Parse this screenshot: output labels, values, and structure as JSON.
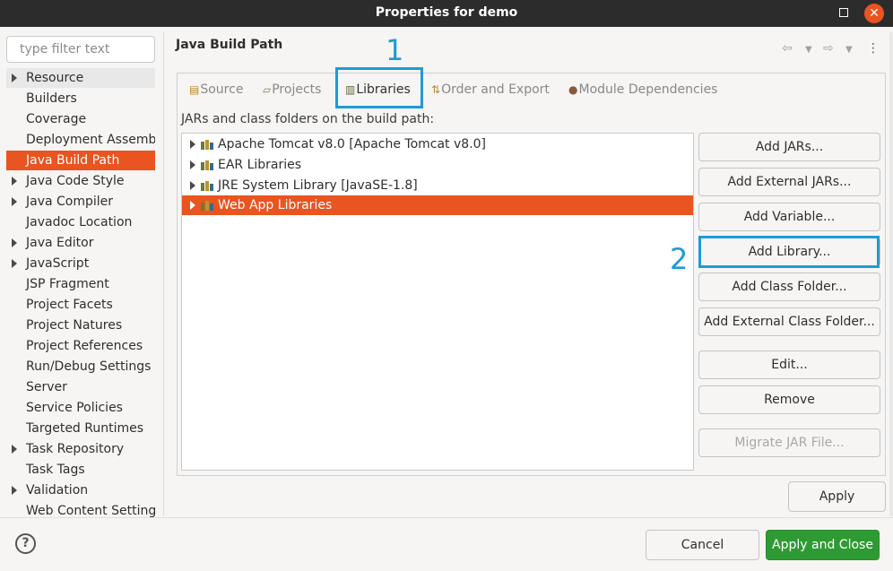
{
  "window": {
    "title": "Properties for demo"
  },
  "filter": {
    "placeholder": "type filter text"
  },
  "sidebar": {
    "items": [
      {
        "label": "Resource",
        "expandable": true,
        "state": "hover"
      },
      {
        "label": "Builders",
        "expandable": false
      },
      {
        "label": "Coverage",
        "expandable": false
      },
      {
        "label": "Deployment Assembly",
        "expandable": false
      },
      {
        "label": "Java Build Path",
        "expandable": false,
        "state": "selected"
      },
      {
        "label": "Java Code Style",
        "expandable": true
      },
      {
        "label": "Java Compiler",
        "expandable": true
      },
      {
        "label": "Javadoc Location",
        "expandable": false
      },
      {
        "label": "Java Editor",
        "expandable": true
      },
      {
        "label": "JavaScript",
        "expandable": true
      },
      {
        "label": "JSP Fragment",
        "expandable": false
      },
      {
        "label": "Project Facets",
        "expandable": false
      },
      {
        "label": "Project Natures",
        "expandable": false
      },
      {
        "label": "Project References",
        "expandable": false
      },
      {
        "label": "Run/Debug Settings",
        "expandable": false
      },
      {
        "label": "Server",
        "expandable": false
      },
      {
        "label": "Service Policies",
        "expandable": false
      },
      {
        "label": "Targeted Runtimes",
        "expandable": false
      },
      {
        "label": "Task Repository",
        "expandable": true
      },
      {
        "label": "Task Tags",
        "expandable": false
      },
      {
        "label": "Validation",
        "expandable": true
      },
      {
        "label": "Web Content Settings",
        "expandable": false
      }
    ]
  },
  "main": {
    "title": "Java Build Path",
    "tabs": [
      {
        "label": "Source",
        "icon": "source-folder-icon"
      },
      {
        "label": "Projects",
        "icon": "projects-folder-icon"
      },
      {
        "label": "Libraries",
        "icon": "library-icon",
        "active": true
      },
      {
        "label": "Order and Export",
        "icon": "order-export-icon"
      },
      {
        "label": "Module Dependencies",
        "icon": "module-icon"
      }
    ],
    "description": "JARs and class folders on the build path:",
    "libraries": [
      {
        "label": "Apache Tomcat v8.0 [Apache Tomcat v8.0]"
      },
      {
        "label": "EAR Libraries"
      },
      {
        "label": "JRE System Library [JavaSE-1.8]"
      },
      {
        "label": "Web App Libraries",
        "selected": true
      }
    ],
    "buttons": {
      "add_jars": "Add JARs...",
      "add_external_jars": "Add External JARs...",
      "add_variable": "Add Variable...",
      "add_library": "Add Library...",
      "add_class_folder": "Add Class Folder...",
      "add_external_class_folder": "Add External Class Folder...",
      "edit": "Edit...",
      "remove": "Remove",
      "migrate_jar": "Migrate JAR File..."
    },
    "apply": "Apply"
  },
  "annotations": {
    "step1": "1",
    "step2": "2"
  },
  "footer": {
    "help": "?",
    "cancel": "Cancel",
    "apply_close": "Apply and Close"
  },
  "colors": {
    "accent": "#e95420",
    "highlight": "#1e9bd7",
    "primary_button": "#2e9a33"
  }
}
